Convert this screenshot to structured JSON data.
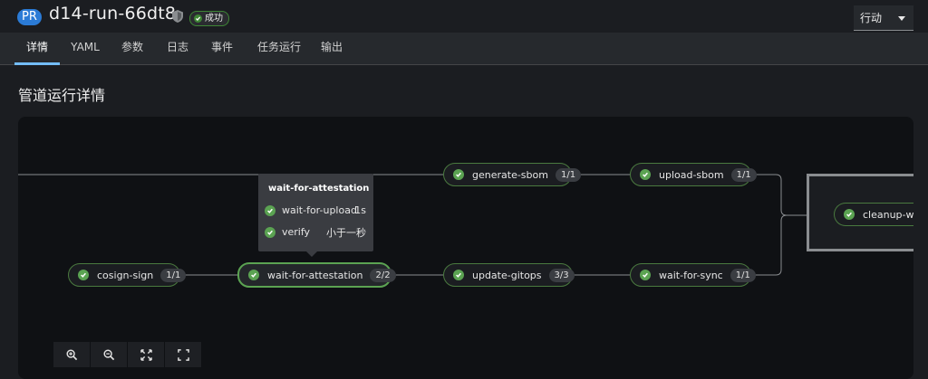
{
  "header": {
    "type_badge": "PR",
    "title": "d14-run-66dt8",
    "status": "成功",
    "actions_label": "行动"
  },
  "tabs": [
    "详情",
    "YAML",
    "参数",
    "日志",
    "事件",
    "任务运行",
    "输出"
  ],
  "active_tab": "详情",
  "page_title": "管道运行详情",
  "pipeline": {
    "nodes": {
      "cosign_sign": {
        "name": "cosign-sign",
        "count": "1/1"
      },
      "wait_for_attestation": {
        "name": "wait-for-attestation",
        "count": "2/2"
      },
      "generate_sbom": {
        "name": "generate-sbom",
        "count": "1/1"
      },
      "update_gitops": {
        "name": "update-gitops",
        "count": "3/3"
      },
      "upload_sbom": {
        "name": "upload-sbom",
        "count": "1/1"
      },
      "wait_for_sync": {
        "name": "wait-for-sync",
        "count": "1/1"
      },
      "cleanup": {
        "name": "cleanup-wor"
      }
    },
    "tooltip": {
      "title": "wait-for-attestation",
      "steps": [
        {
          "name": "wait-for-upload",
          "time": "1s"
        },
        {
          "name": "verify",
          "time": "小于一秒"
        }
      ]
    }
  },
  "zoom_controls": [
    "zoom-in-icon",
    "zoom-out-icon",
    "fit-to-screen-icon",
    "expand-icon"
  ],
  "colors": {
    "success": "#3e8635",
    "accent": "#73bcf7",
    "pr_badge": "#2b7bd6"
  }
}
